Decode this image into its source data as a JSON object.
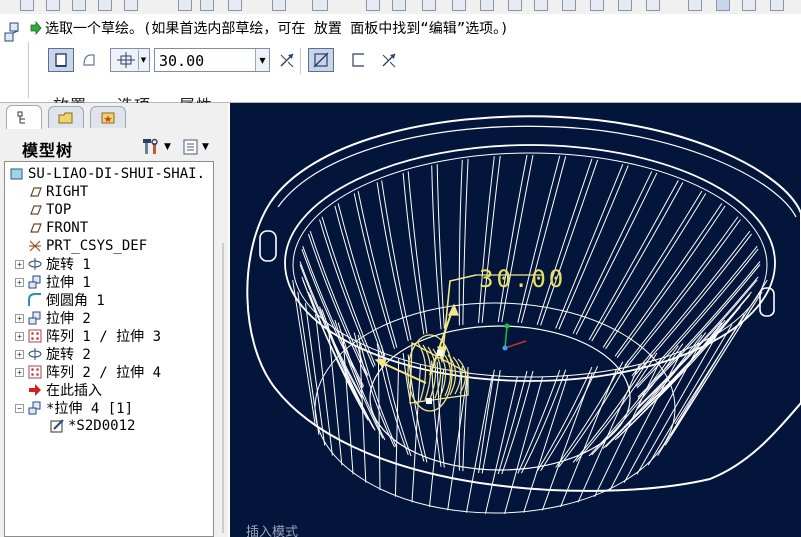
{
  "message_line": {
    "text": "选取一个草绘。(如果首选内部草绘，可在 放置 面板中找到“编辑”选项。)"
  },
  "dashboard": {
    "depth_value": "30.00",
    "tabs": [
      "放置",
      "选项",
      "属性"
    ]
  },
  "model_tree": {
    "title": "模型树",
    "items": [
      {
        "label": "SU-LIAO-DI-SHUI-SHAI.",
        "icon": "part-icon",
        "expander": ""
      },
      {
        "label": "RIGHT",
        "icon": "datum-plane-icon",
        "expander": ""
      },
      {
        "label": "TOP",
        "icon": "datum-plane-icon",
        "expander": ""
      },
      {
        "label": "FRONT",
        "icon": "datum-plane-icon",
        "expander": ""
      },
      {
        "label": "PRT_CSYS_DEF",
        "icon": "csys-icon",
        "expander": ""
      },
      {
        "label": "旋转 1",
        "icon": "revolve-icon",
        "expander": "+"
      },
      {
        "label": "拉伸 1",
        "icon": "extrude-icon",
        "expander": "+"
      },
      {
        "label": "倒圆角 1",
        "icon": "round-icon",
        "expander": ""
      },
      {
        "label": "拉伸 2",
        "icon": "extrude-icon",
        "expander": "+"
      },
      {
        "label": "阵列 1 / 拉伸 3",
        "icon": "pattern-icon",
        "expander": "+"
      },
      {
        "label": "旋转 2",
        "icon": "revolve-icon",
        "expander": "+"
      },
      {
        "label": "阵列 2 / 拉伸 4",
        "icon": "pattern-icon",
        "expander": "+"
      },
      {
        "label": "在此插入",
        "icon": "insert-arrow-icon",
        "expander": ""
      },
      {
        "label": "*拉伸 4 [1]",
        "icon": "extrude-icon",
        "expander": "-"
      },
      {
        "label": "*S2D0012",
        "icon": "sketch-icon",
        "expander": ""
      }
    ]
  },
  "viewport": {
    "dimension_label": "30.00",
    "mode_label": "插入模式"
  },
  "colors": {
    "viewport_bg": "#03153a",
    "model_lines": "#ffffff",
    "preview": "#f0e68c",
    "tree_text": "#000000"
  }
}
